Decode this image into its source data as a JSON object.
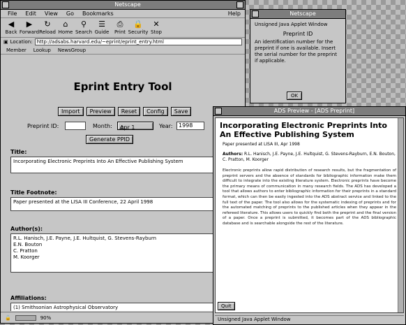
{
  "desktop": {},
  "main_window": {
    "title": "Netscape",
    "menu": [
      "File",
      "Edit",
      "View",
      "Go",
      "Bookmarks"
    ],
    "help": "Help",
    "toolbar": [
      {
        "label": "Back",
        "icon": "back-icon",
        "glyph": "◀"
      },
      {
        "label": "Forward",
        "icon": "forward-icon",
        "glyph": "▶"
      },
      {
        "label": "Reload",
        "icon": "reload-icon",
        "glyph": "↻"
      },
      {
        "label": "Home",
        "icon": "home-icon",
        "glyph": "⌂"
      },
      {
        "label": "Search",
        "icon": "search-icon",
        "glyph": "⚲"
      },
      {
        "label": "Guide",
        "icon": "guide-icon",
        "glyph": "☰"
      },
      {
        "label": "Print",
        "icon": "print-icon",
        "glyph": "⎙"
      },
      {
        "label": "Security",
        "icon": "security-icon",
        "glyph": "🔒"
      },
      {
        "label": "Stop",
        "icon": "stop-icon",
        "glyph": "✕"
      }
    ],
    "location_label": "Location:",
    "location_url": "http://adsabs.harvard.edu/~eprint/eprint_entry.html",
    "directory_buttons": [
      "Member",
      "Lookup",
      "NewsGroup"
    ],
    "app_title": "Eprint Entry Tool",
    "buttons": [
      "Import",
      "Preview",
      "Reset",
      "Config",
      "Save"
    ],
    "preprint_id_label": "Preprint ID:",
    "preprint_id_value": "",
    "month_label": "Month:",
    "month_value": "Apr 1",
    "year_label": "Year:",
    "year_value": "1998",
    "generate_label": "Generate PPID",
    "title_label": "Title:",
    "title_value": "Incorporating Electronic Preprints Into An Effective Publishing System",
    "footnote_label": "Title Footnote:",
    "footnote_value": "Paper presented at the LISA III Conference, 22 April 1998",
    "authors_label": "Author(s):",
    "authors_value": [
      "R.L. Hanisch, J.E. Payne, J.E. Hultquist, G. Stevens-Rayburn",
      "E.N. Bouton",
      "C. Pratton",
      "M. Koorger"
    ],
    "affiliations_label": "Affiliations:",
    "affiliations_value": "(1) Smithsonian Astrophysical Observatory",
    "status_zoom": "90%"
  },
  "popup_window": {
    "title": "Netscape",
    "unsigned": "Unsigned Java Applet Window",
    "heading": "Preprint ID",
    "text": "An identification number for the preprint if one is available. Insert the serial number for the preprint if applicable.",
    "ok_label": "OK"
  },
  "preprint_window": {
    "title": "ADS Preview - [ADS Preprint]",
    "paper_title": "Incorporating Electronic Preprints Into An Effective Publishing System",
    "published": "Paper presented at LISA III, Apr 1998",
    "authors_label": "Authors:",
    "authors": "R.L. Hanisch, J.E. Payne, J.E. Hultquist, G. Stevens-Rayburn, E.N. Bouton, C. Pratton, M. Koorger",
    "abstract": "Electronic preprints allow rapid distribution of research results, but the fragmentation of preprint servers and the absence of standards for bibliographic information make them difficult to integrate into the existing literature system. Electronic preprints have become the primary means of communication in many research fields. The ADS has developed a tool that allows authors to enter bibliographic information for their preprints in a standard format, which can then be easily ingested into the ADS abstract service and linked to the full text of the paper. The tool also allows for the systematic indexing of preprints and for the automated matching of preprints to the published articles when they appear in the refereed literature. This allows users to quickly find both the preprint and the final version of a paper. Once a preprint is submitted, it becomes part of the ADS bibliographic database and is searchable alongside the rest of the literature.",
    "quit_label": "Quit",
    "status": "Unsigned Java Applet Window"
  }
}
